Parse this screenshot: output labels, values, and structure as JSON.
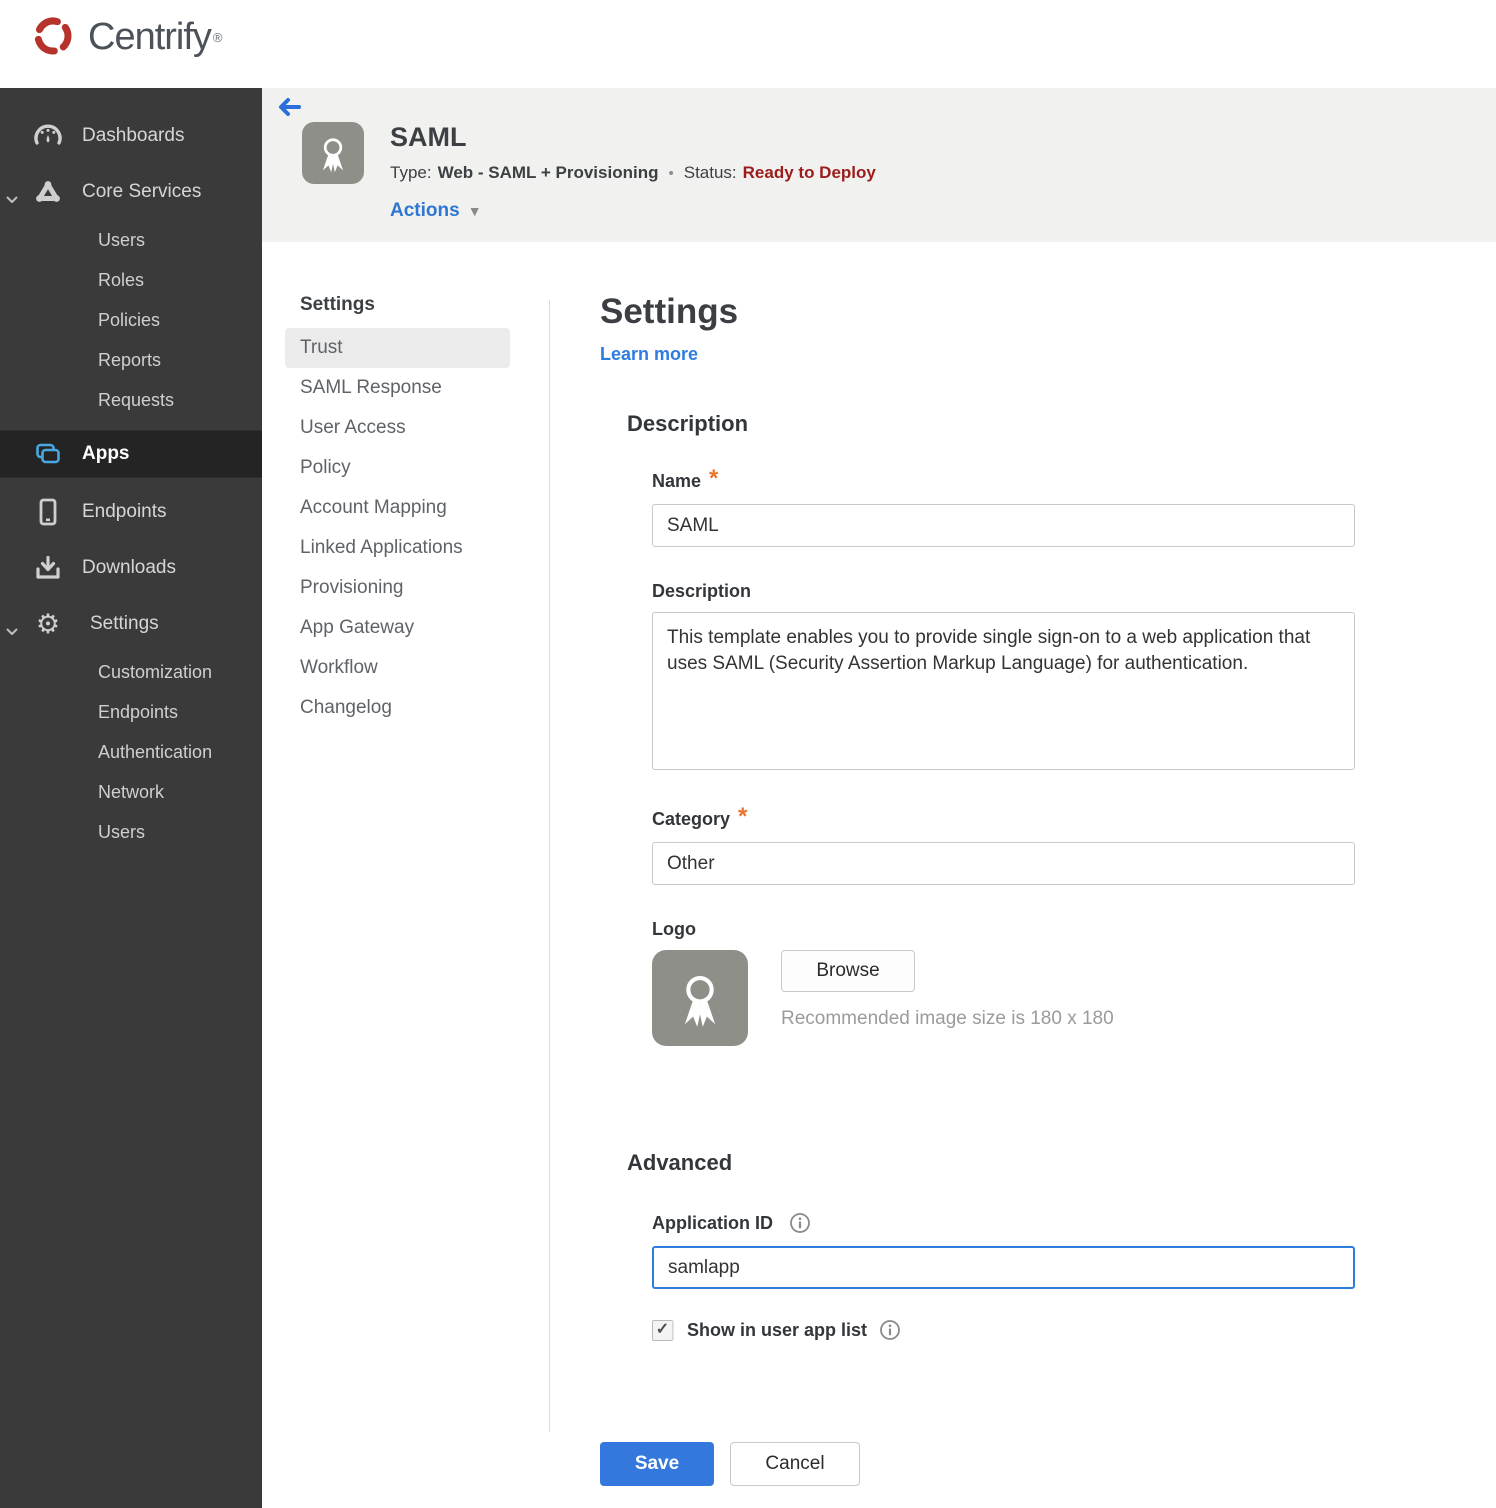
{
  "topbar": {
    "brand": "Centrify",
    "registered": "®"
  },
  "sidebar": {
    "dashboards": "Dashboards",
    "core_services": "Core Services",
    "core_children": [
      "Users",
      "Roles",
      "Policies",
      "Reports",
      "Requests"
    ],
    "apps": "Apps",
    "endpoints": "Endpoints",
    "downloads": "Downloads",
    "settings": "Settings",
    "settings_children": [
      "Customization",
      "Endpoints",
      "Authentication",
      "Network",
      "Users"
    ]
  },
  "header": {
    "title": "SAML",
    "type_label": "Type:",
    "type_value": "Web - SAML + Provisioning",
    "status_label": "Status:",
    "status_value": "Ready to Deploy",
    "actions": "Actions"
  },
  "subnav": {
    "heading": "Settings",
    "selected": "Trust",
    "items": [
      "Trust",
      "SAML Response",
      "User Access",
      "Policy",
      "Account Mapping",
      "Linked Applications",
      "Provisioning",
      "App Gateway",
      "Workflow",
      "Changelog"
    ]
  },
  "main": {
    "heading": "Settings",
    "learn_more": "Learn more",
    "description_section": "Description",
    "name_label": "Name",
    "name_value": "SAML",
    "description_label": "Description",
    "description_value": "This template enables you to provide single sign-on to a web application that uses SAML (Security Assertion Markup Language) for authentication.",
    "category_label": "Category",
    "category_value": "Other",
    "logo_label": "Logo",
    "browse_button": "Browse",
    "logo_hint": "Recommended image size is 180 x 180",
    "advanced_section": "Advanced",
    "app_id_label": "Application ID",
    "app_id_value": "samlapp",
    "show_in_app_list_label": "Show in user app list",
    "show_in_app_list_checked": true,
    "save_button": "Save",
    "cancel_button": "Cancel"
  },
  "glyphs": {
    "required_star": "*",
    "meta_separator": "•",
    "actions_caret": "▼",
    "gear": "⚙",
    "check": "✓"
  },
  "colors": {
    "accent_blue": "#2e7ce0",
    "save_blue": "#3478dd",
    "status_red": "#9c1c1c",
    "required_orange": "#e8752c",
    "sidebar_bg": "#3a3a3a",
    "sidebar_selected_bg": "#242424",
    "apps_icon_blue": "#49a8e2",
    "header_bg": "#f1f1f0",
    "brand_red": "#b5332a"
  }
}
